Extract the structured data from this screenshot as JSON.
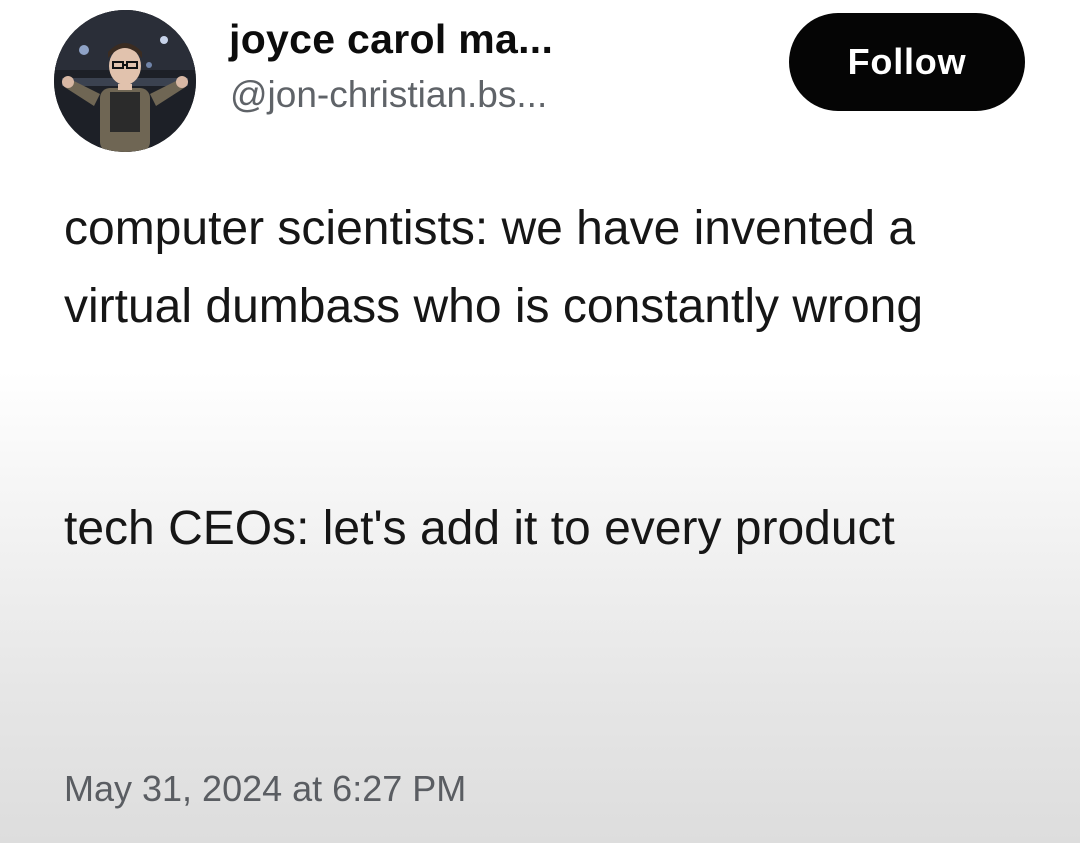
{
  "author": {
    "display_name": "joyce carol ma...",
    "handle": "@jon-christian.bs..."
  },
  "actions": {
    "follow_label": "Follow"
  },
  "post": {
    "paragraphs": [
      "computer scientists: we have invented a virtual dumbass who is constantly wrong",
      "tech CEOs: let's add it to every product"
    ],
    "timestamp": "May 31, 2024 at 6:27 PM"
  }
}
